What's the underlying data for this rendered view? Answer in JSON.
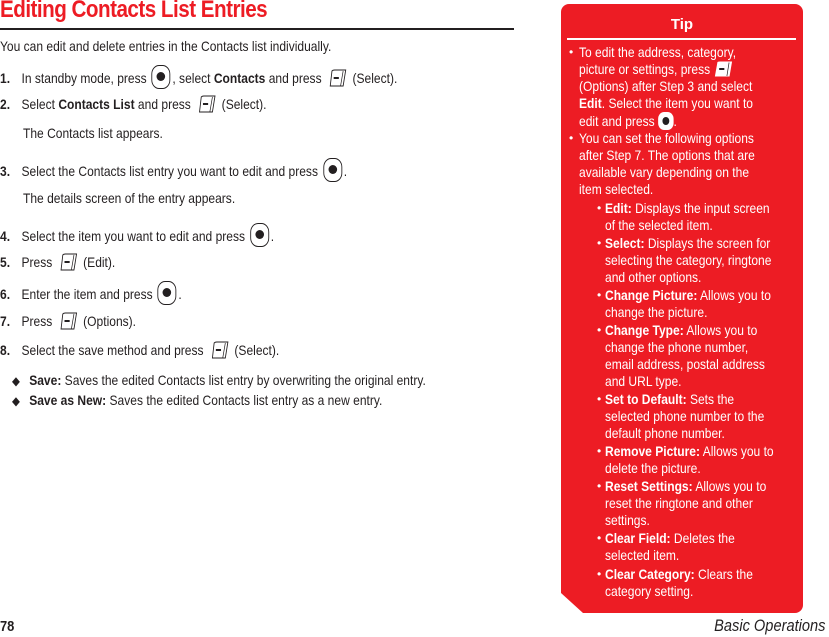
{
  "page": {
    "title": "Editing Contacts List Entries",
    "intro": "You can edit and delete entries in the Contacts list individually.",
    "page_number": "78",
    "section_name": "Basic Operations"
  },
  "icons": {
    "center_key": "center-select-key-icon",
    "soft_key": "soft-key-icon",
    "bullet_diamond": "◆",
    "bullet_dot": "•"
  },
  "steps": [
    {
      "num": "1.",
      "pre": "In standby mode, press ",
      "mid": ", select ",
      "bold": "Contacts",
      "post": " and press ",
      "end": "(Select)."
    },
    {
      "num": "2.",
      "pre": "Select ",
      "bold": "Contacts List",
      "post": " and press ",
      "end": "(Select).",
      "note": "The Contacts list appears."
    },
    {
      "num": "3.",
      "pre": "Select the Contacts list entry you want to edit and press ",
      "end": ".",
      "note": "The details screen of the entry appears."
    },
    {
      "num": "4.",
      "pre": "Select the item you want to edit and press ",
      "end": "."
    },
    {
      "num": "5.",
      "pre": "Press ",
      "end": "(Edit)."
    },
    {
      "num": "6.",
      "pre": "Enter the item and press ",
      "end": "."
    },
    {
      "num": "7.",
      "pre": "Press ",
      "end": "(Options)."
    },
    {
      "num": "8.",
      "pre": "Select the save method and press ",
      "end": "(Select)."
    }
  ],
  "save_options": [
    {
      "label": "Save:",
      "desc": " Saves the edited Contacts list entry by overwriting the original entry."
    },
    {
      "label": "Save as New:",
      "desc": " Saves the edited Contacts list entry as a new entry."
    }
  ],
  "tip": {
    "title": "Tip",
    "bullet1": {
      "lines": [
        "To edit the address, category,",
        "picture or settings, press",
        "(Options) after Step 3 and select"
      ],
      "edit_bold": "Edit",
      "edit_rest": ". Select the item you want to",
      "last": "edit and press",
      "last_end": "."
    },
    "bullet2": {
      "lines": [
        "You can set the following options",
        "after Step 7. The options that are",
        "available vary depending on the",
        "item selected."
      ]
    },
    "options": [
      {
        "label": "Edit:",
        "lines": [
          " Displays the input screen",
          "of the selected item."
        ]
      },
      {
        "label": "Select:",
        "lines": [
          " Displays the screen for",
          "selecting the category, ringtone",
          "and other options."
        ]
      },
      {
        "label": "Change Picture:",
        "lines": [
          " Allows you to",
          "change the picture."
        ]
      },
      {
        "label": "Change Type:",
        "lines": [
          " Allows you to",
          "change the phone number,",
          "email address, postal address",
          "and URL type."
        ]
      },
      {
        "label": "Set to Default:",
        "lines": [
          " Sets the",
          "selected phone number to the",
          "default phone number."
        ]
      },
      {
        "label": "Remove Picture:",
        "lines": [
          " Allows you to",
          "delete the picture."
        ]
      },
      {
        "label": "Reset Settings:",
        "lines": [
          " Allows you to",
          "reset the ringtone and other",
          "settings."
        ]
      },
      {
        "label": "Clear Field:",
        "lines": [
          " Deletes the",
          "selected item."
        ]
      },
      {
        "label": "Clear Category:",
        "lines": [
          " Clears the",
          "category setting."
        ]
      }
    ]
  },
  "colors": {
    "accent_red": "#ed1c24",
    "text": "#231f20"
  }
}
